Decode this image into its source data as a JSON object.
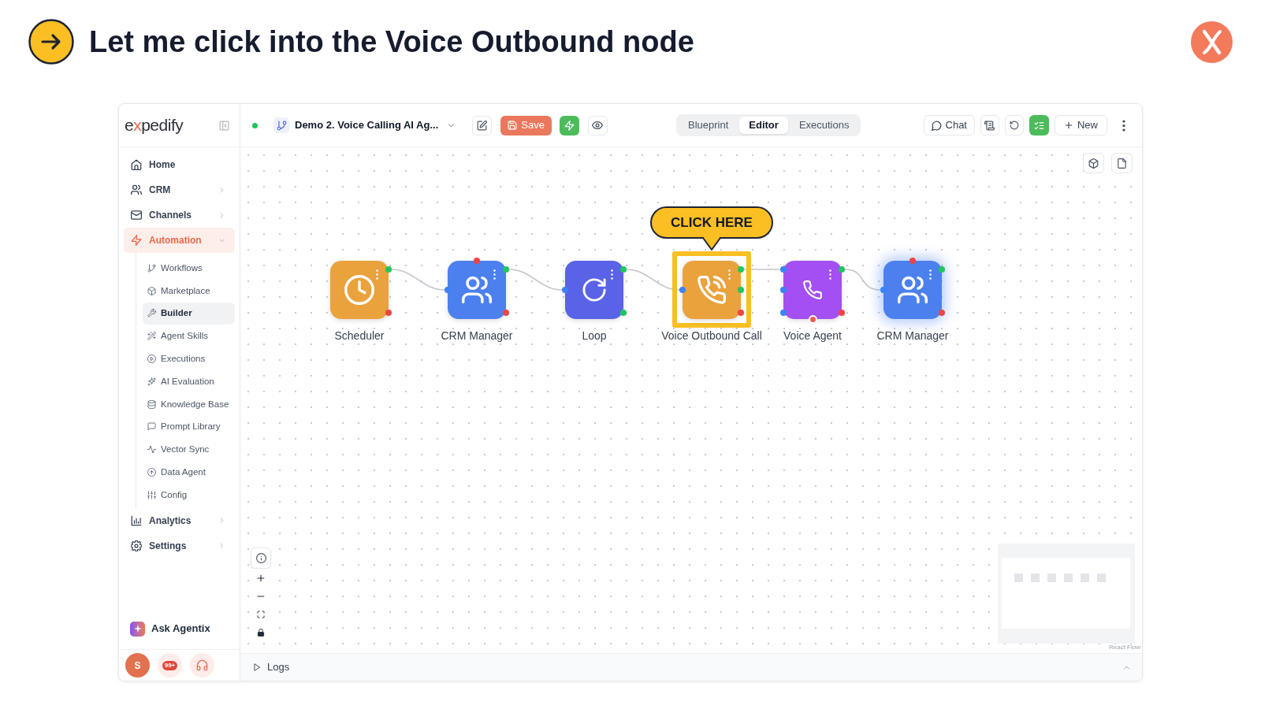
{
  "header": {
    "title": "Let me click into the Voice Outbound node"
  },
  "sidebar": {
    "logo": [
      {
        "text": "e",
        "accent": false
      },
      {
        "text": "x",
        "accent": true
      },
      {
        "text": "pedify",
        "accent": false
      }
    ],
    "items": [
      {
        "label": "Home",
        "kind": "link",
        "selected": false
      },
      {
        "label": "CRM",
        "kind": "group",
        "expanded": false,
        "selected": false
      },
      {
        "label": "Channels",
        "kind": "group",
        "expanded": false,
        "selected": false
      },
      {
        "label": "Automation",
        "kind": "group",
        "expanded": true,
        "selected": true,
        "children": [
          {
            "label": "Workflows",
            "selected": false
          },
          {
            "label": "Marketplace",
            "selected": false
          },
          {
            "label": "Builder",
            "selected": true
          },
          {
            "label": "Agent Skills",
            "selected": false
          },
          {
            "label": "Executions",
            "selected": false
          },
          {
            "label": "AI Evaluation",
            "selected": false
          },
          {
            "label": "Knowledge Base",
            "selected": false
          },
          {
            "label": "Prompt Library",
            "selected": false
          },
          {
            "label": "Vector Sync",
            "selected": false
          },
          {
            "label": "Data Agent",
            "selected": false
          },
          {
            "label": "Config",
            "selected": false
          }
        ]
      },
      {
        "label": "Analytics",
        "kind": "group",
        "expanded": false,
        "selected": false
      },
      {
        "label": "Settings",
        "kind": "group",
        "expanded": false,
        "selected": false
      }
    ],
    "assistant": {
      "label": "Ask Agentix"
    },
    "footer": {
      "avatar": "S",
      "notifications": "99+"
    }
  },
  "toolbar": {
    "live": true,
    "workflow_name": "Demo 2. Voice Calling AI Ag...",
    "save": "Save",
    "views": [
      {
        "label": "Blueprint",
        "selected": false
      },
      {
        "label": "Editor",
        "selected": true
      },
      {
        "label": "Executions",
        "selected": false
      }
    ],
    "chat": "Chat",
    "new": "New"
  },
  "canvas": {
    "nodes": [
      {
        "kind": "scheduler",
        "label": "Scheduler",
        "color": "#eaa23c",
        "selected": false,
        "hovered": false
      },
      {
        "kind": "crm",
        "label": "CRM Manager",
        "color": "#4c80ef",
        "selected": false,
        "hovered": false
      },
      {
        "kind": "loop",
        "label": "Loop",
        "color": "#5a62e8",
        "selected": false,
        "hovered": false
      },
      {
        "kind": "voice_call",
        "label": "Voice Outbound Call",
        "color": "#eaa23c",
        "selected": true,
        "hovered": false
      },
      {
        "kind": "voice_agent",
        "label": "Voice Agent",
        "color": "#a44ff1",
        "selected": false,
        "hovered": false
      },
      {
        "kind": "crm",
        "label": "CRM Manager",
        "color": "#4c80ef",
        "selected": false,
        "hovered": true
      }
    ],
    "callout": "CLICK HERE",
    "attribution": "React Flow"
  },
  "logs": {
    "label": "Logs",
    "expanded": false
  }
}
